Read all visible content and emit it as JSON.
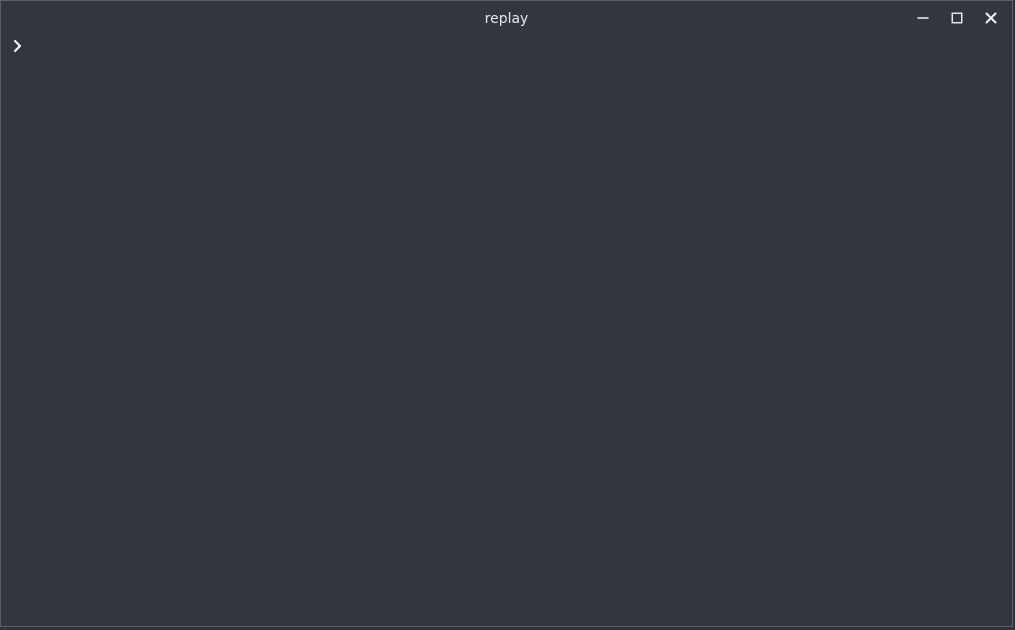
{
  "window": {
    "title": "replay",
    "controls": {
      "minimize": "minimize-icon",
      "maximize": "maximize-icon",
      "close": "close-icon"
    },
    "colors": {
      "background": "#323641",
      "border": "#5b5f68",
      "text": "#e7e7e7"
    }
  },
  "console": {
    "prompt_icon": "chevron-right-icon",
    "input_value": ""
  }
}
